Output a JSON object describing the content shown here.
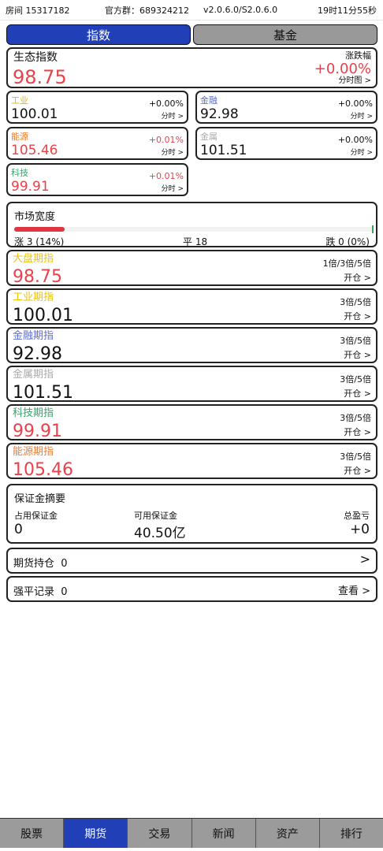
{
  "status": {
    "room": "房间 15317182",
    "group": "官方群：689324212",
    "version": "v2.0.6.0/S2.0.6.0",
    "time": "19时11分55秒"
  },
  "main_tabs": [
    {
      "label": "指数",
      "active": true
    },
    {
      "label": "基金",
      "active": false
    }
  ],
  "eco_index": {
    "label": "生态指数",
    "value": "98.75",
    "change_label": "涨跌幅",
    "change": "+0.00%",
    "link": "分时图 >"
  },
  "sectors": [
    {
      "name": "工业",
      "value": "100.01",
      "pct": "+0.00%",
      "link": "分时 >",
      "name_color": "#e8b400",
      "value_color": "#111111",
      "pct_color": "#111111"
    },
    {
      "name": "金融",
      "value": "92.98",
      "pct": "+0.00%",
      "link": "分时 >",
      "name_color": "#5b6bd8",
      "value_color": "#111111",
      "pct_color": "#111111"
    },
    {
      "name": "能源",
      "value": "105.46",
      "pct": "+0.01%",
      "link": "分时 >",
      "name_color": "#ef7d2c",
      "value_color": "#e8424a",
      "pct_color": "#e8424a"
    },
    {
      "name": "金属",
      "value": "101.51",
      "pct": "+0.00%",
      "link": "分时 >",
      "name_color": "#aaaaaa",
      "value_color": "#111111",
      "pct_color": "#111111"
    },
    {
      "name": "科技",
      "value": "99.91",
      "pct": "+0.01%",
      "link": "分时 >",
      "name_color": "#2da66b",
      "value_color": "#e8424a",
      "pct_color": "#e8424a"
    }
  ],
  "breadth": {
    "title": "市场宽度",
    "up": "涨 3 (14%)",
    "flat": "平 18",
    "down": "跌 0 (0%)",
    "up_fraction": 0.14,
    "down_fraction": 0.0
  },
  "futures": [
    {
      "name": "大盘期指",
      "value": "98.75",
      "leverage": "1倍/3倍/5倍",
      "open": "开仓 >",
      "name_color": "#f0c400",
      "value_color": "#e8424a"
    },
    {
      "name": "工业期指",
      "value": "100.01",
      "leverage": "3倍/5倍",
      "open": "开仓 >",
      "name_color": "#f0c400",
      "value_color": "#111111"
    },
    {
      "name": "金融期指",
      "value": "92.98",
      "leverage": "3倍/5倍",
      "open": "开仓 >",
      "name_color": "#5b6bd8",
      "value_color": "#111111"
    },
    {
      "name": "金属期指",
      "value": "101.51",
      "leverage": "3倍/5倍",
      "open": "开仓 >",
      "name_color": "#aaaaaa",
      "value_color": "#111111"
    },
    {
      "name": "科技期指",
      "value": "99.91",
      "leverage": "3倍/5倍",
      "open": "开仓 >",
      "name_color": "#2da66b",
      "value_color": "#e8424a"
    },
    {
      "name": "能源期指",
      "value": "105.46",
      "leverage": "3倍/5倍",
      "open": "开仓 >",
      "name_color": "#ef7d2c",
      "value_color": "#e8424a"
    }
  ],
  "margin": {
    "title": "保证金摘要",
    "used_label": "占用保证金",
    "used": "0",
    "available_label": "可用保证金",
    "available": "40.50亿",
    "pnl_label": "总盈亏",
    "pnl": "+0"
  },
  "positions": {
    "label": "期货持仓",
    "count": "0",
    "arrow": ">"
  },
  "liquidations": {
    "label": "强平记录",
    "count": "0",
    "view": "查看 >"
  },
  "bottom_nav": [
    {
      "label": "股票",
      "active": false
    },
    {
      "label": "期货",
      "active": true
    },
    {
      "label": "交易",
      "active": false
    },
    {
      "label": "新闻",
      "active": false
    },
    {
      "label": "资产",
      "active": false
    },
    {
      "label": "排行",
      "active": false
    }
  ]
}
